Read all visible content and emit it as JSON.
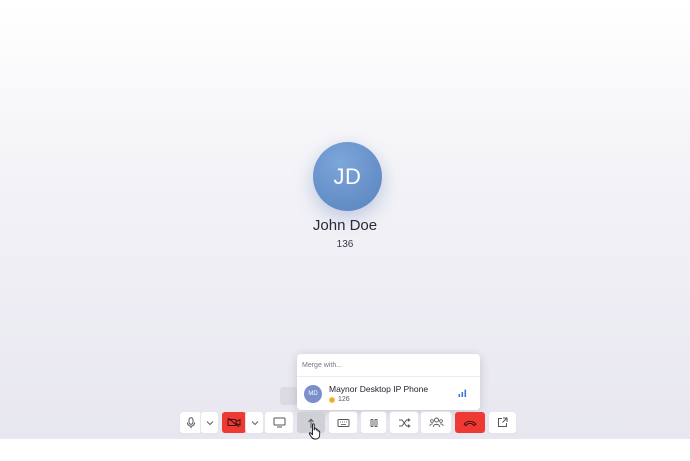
{
  "caller": {
    "initials": "JD",
    "name": "John Doe",
    "extension": "136"
  },
  "merge_popup": {
    "header": "Merge with...",
    "items": [
      {
        "initials": "MD",
        "name": "Maynor Desktop IP Phone",
        "extension": "126",
        "status_color": "#e4a11b",
        "icon": "signal-bars-icon"
      }
    ]
  },
  "toolbar": {
    "buttons": [
      {
        "name": "mute-button",
        "icon": "microphone-icon"
      },
      {
        "name": "audio-options-dropdown",
        "icon": "chevron-down-icon"
      },
      {
        "name": "video-off-button",
        "icon": "video-off-icon",
        "active_color": "#ee3a33"
      },
      {
        "name": "video-options-dropdown",
        "icon": "chevron-down-icon"
      },
      {
        "name": "screen-share-button",
        "icon": "monitor-icon"
      },
      {
        "name": "merge-button",
        "icon": "merge-arrow-icon",
        "state": "pressed"
      },
      {
        "name": "keypad-button",
        "icon": "keyboard-icon"
      },
      {
        "name": "hold-button",
        "icon": "pause-icon"
      },
      {
        "name": "transfer-button",
        "icon": "shuffle-icon"
      },
      {
        "name": "participants-button",
        "icon": "people-icon"
      },
      {
        "name": "hangup-button",
        "icon": "phone-hangup-icon",
        "active_color": "#ee3a33"
      },
      {
        "name": "popout-button",
        "icon": "external-link-icon"
      }
    ]
  },
  "colors": {
    "avatar": "#6690c8",
    "danger": "#ee3a33",
    "away_status": "#e4a11b"
  }
}
